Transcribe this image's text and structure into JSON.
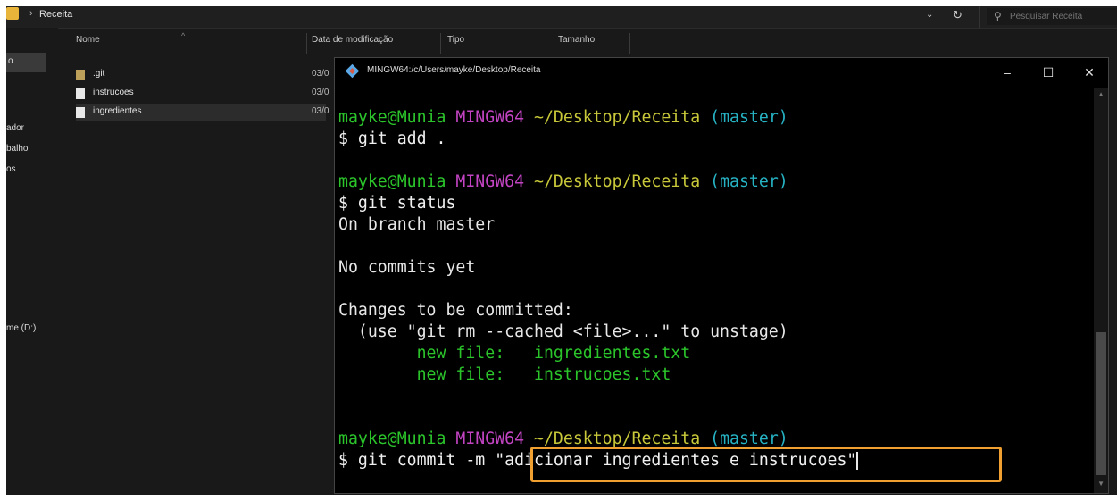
{
  "explorer": {
    "breadcrumb": "Receita",
    "search_placeholder": "Pesquisar Receita",
    "nav_items": [
      "o",
      "ador",
      "balho",
      "os",
      "me (D:)"
    ],
    "columns": [
      "Nome",
      "Data de modificação",
      "Tipo",
      "Tamanho"
    ],
    "files": [
      {
        "name": ".git",
        "date": "03/0",
        "kind": "folder"
      },
      {
        "name": "instrucoes",
        "date": "03/0",
        "kind": "doc"
      },
      {
        "name": "ingredientes",
        "date": "03/0",
        "kind": "doc"
      }
    ]
  },
  "terminal": {
    "title": "MINGW64:/c/Users/mayke/Desktop/Receita",
    "controls": {
      "minimize": "–",
      "maximize": "☐",
      "close": "✕"
    },
    "prompt": {
      "user": "mayke@Munia",
      "env": "MINGW64",
      "path": "~/Desktop/Receita",
      "branch": "(master)"
    },
    "lines": {
      "cmd1": "$ git add .",
      "cmd2": "$ git status",
      "out1": "On branch master",
      "out2": "No commits yet",
      "out3": "Changes to be committed:",
      "out4": "  (use \"git rm --cached <file>...\" to unstage)",
      "new1": "        new file:   ingredientes.txt",
      "new2": "        new file:   instrucoes.txt",
      "cmd3_prefix": "$ git commit -m ",
      "cmd3_message": "\"adicionar ingredientes e instrucoes\""
    }
  },
  "colors": {
    "prompt_user": "#2bc52b",
    "prompt_env": "#c244c2",
    "prompt_path": "#c8c83a",
    "prompt_branch": "#26b3c4",
    "highlight": "#f0a030"
  }
}
